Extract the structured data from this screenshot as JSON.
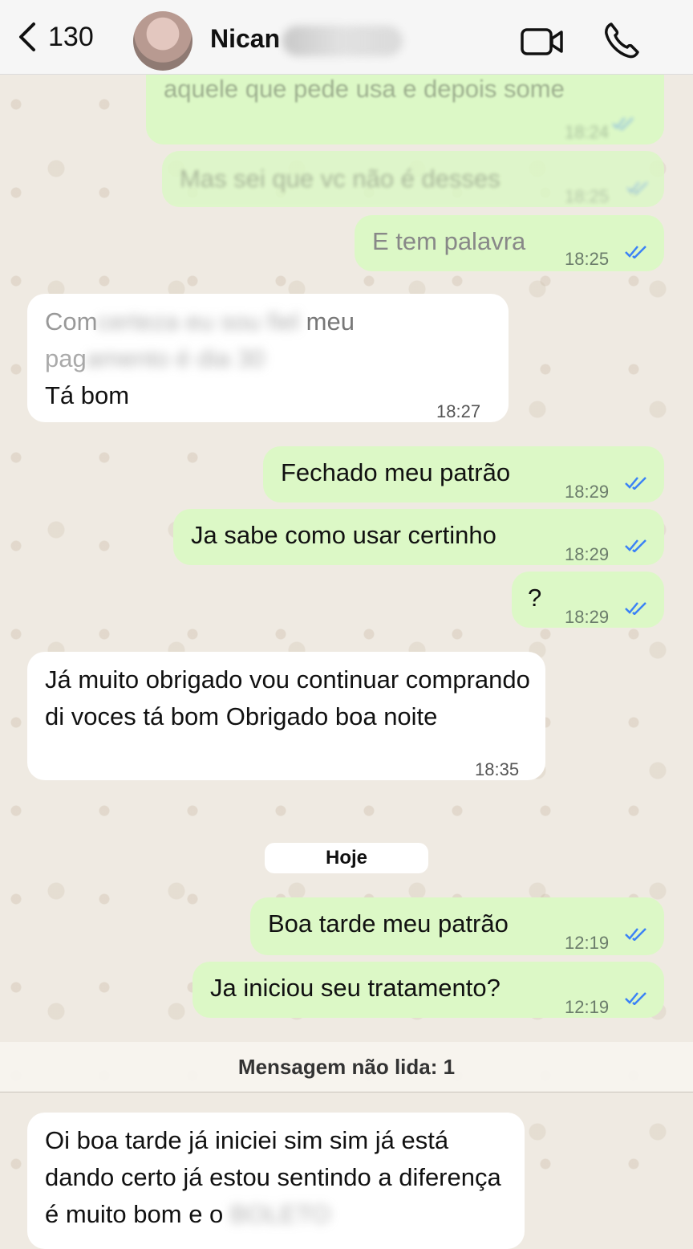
{
  "header": {
    "back_count": "130",
    "contact_name": "Nican"
  },
  "messages": [
    {
      "text": "aquele que pede usa e depois some",
      "time": "18:24"
    },
    {
      "text": "Mas sei que vc não é desses",
      "time": "18:25"
    },
    {
      "text": "E tem palavra",
      "time": "18:25"
    },
    {
      "line1_clear": "Com",
      "line1_blur": "certeza eu sou fiel",
      "line1_end": "meu",
      "line2_clear": "pag",
      "line2_blur": "amento é dia 30",
      "line3": "Tá bom",
      "time": "18:27"
    },
    {
      "text": "Fechado meu patrão",
      "time": "18:29"
    },
    {
      "text": "Ja sabe como usar certinho",
      "time": "18:29"
    },
    {
      "text": "?",
      "time": "18:29"
    },
    {
      "text": "Já muito obrigado vou continuar comprando di voces tá bom Obrigado boa noite",
      "time": "18:35"
    },
    {
      "text": "Boa tarde meu patrão",
      "time": "12:19"
    },
    {
      "text": "Ja iniciou seu tratamento?",
      "time": "12:19"
    },
    {
      "text": "Oi boa tarde já iniciei sim sim já está dando certo já estou sentindo a diferença é muito bom e o",
      "blur_tail": "BOLETO"
    }
  ],
  "date_separator": "Hoje",
  "unread_banner": "Mensagem não lida: 1",
  "colors": {
    "outgoing_bubble": "#dcf8c6",
    "incoming_bubble": "#ffffff",
    "read_ticks": "#3b82f6",
    "wallpaper": "#efeae2"
  },
  "icons": [
    "chevron-left-icon",
    "video-camera-icon",
    "phone-icon",
    "double-check-icon"
  ]
}
